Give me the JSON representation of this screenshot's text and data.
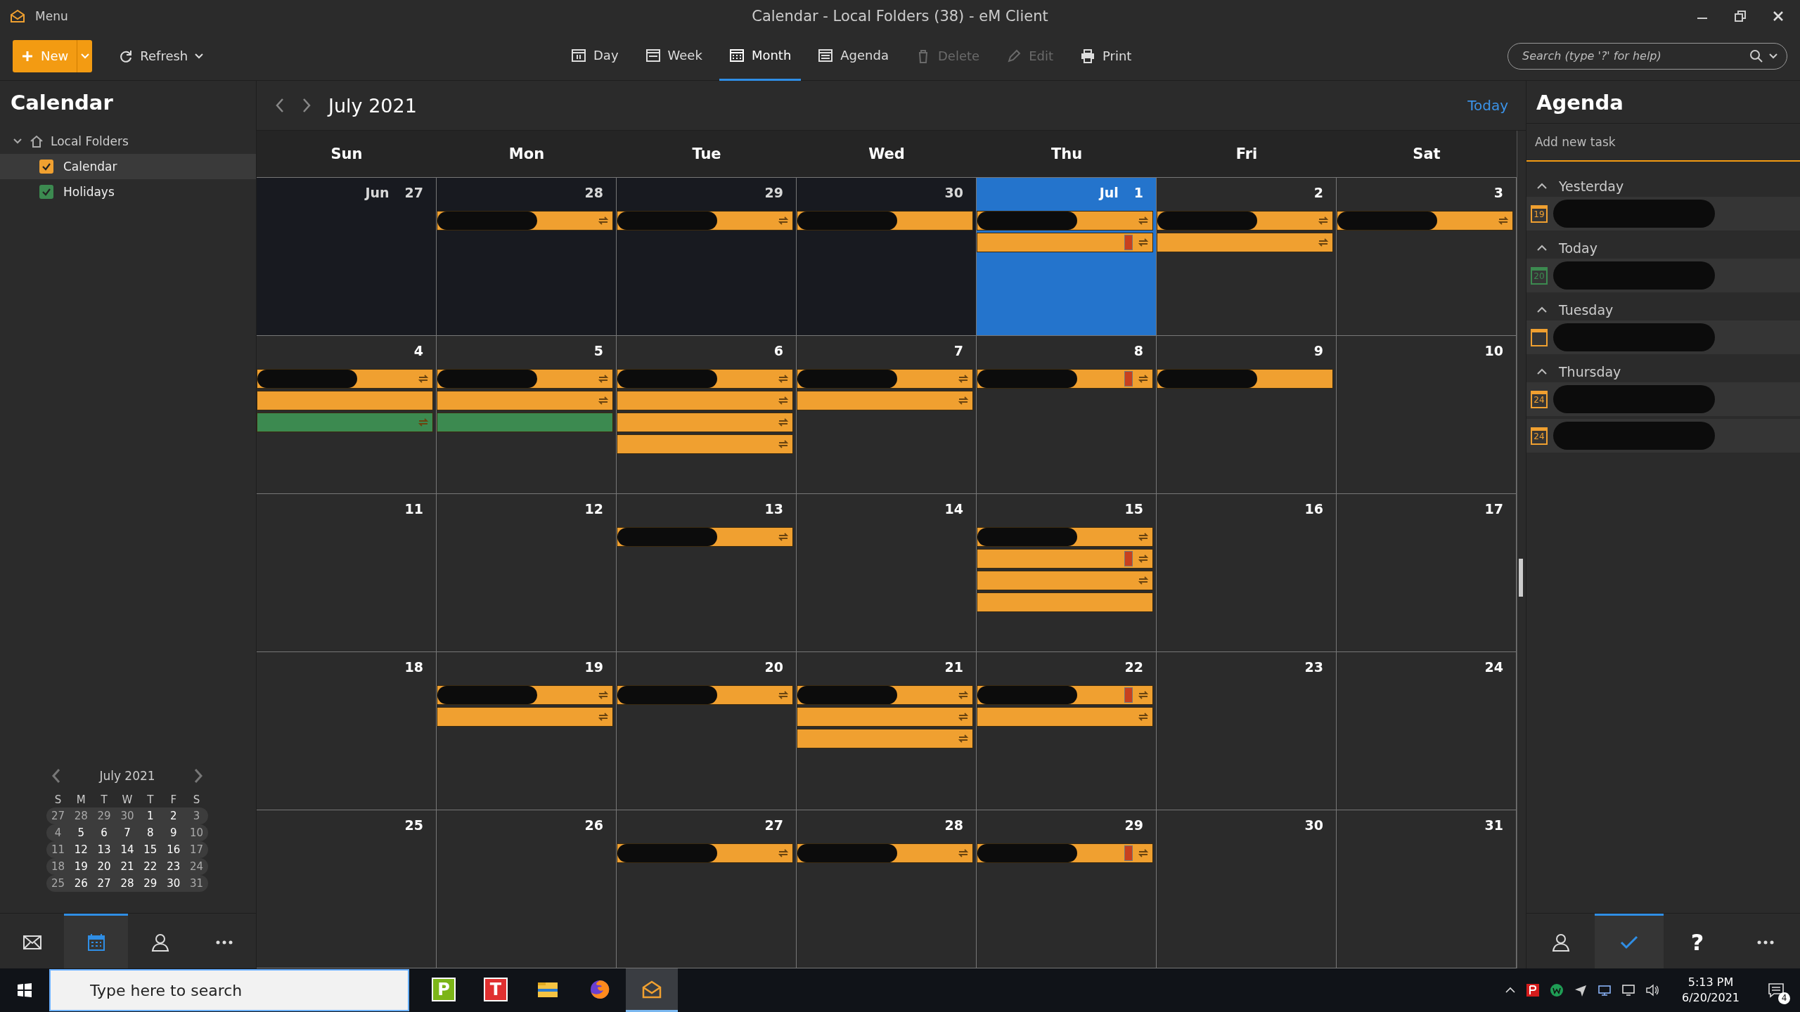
{
  "window": {
    "menu": "Menu",
    "title": "Calendar - Local Folders (38) - eM Client"
  },
  "toolbar": {
    "new": "New",
    "refresh": "Refresh",
    "views": [
      {
        "kind": "day",
        "label": "Day",
        "selected": false
      },
      {
        "kind": "week",
        "label": "Week",
        "selected": false
      },
      {
        "kind": "month",
        "label": "Month",
        "selected": true
      },
      {
        "kind": "agenda",
        "label": "Agenda",
        "selected": false
      }
    ],
    "actions": [
      {
        "kind": "delete",
        "label": "Delete",
        "disabled": true
      },
      {
        "kind": "edit",
        "label": "Edit",
        "disabled": true
      },
      {
        "kind": "print",
        "label": "Print",
        "disabled": false
      }
    ],
    "search": {
      "placeholder": "Search (type '?' for help)"
    }
  },
  "sidebar": {
    "title": "Calendar",
    "tree": [
      {
        "label": "Local Folders",
        "expanded": true,
        "children": [
          {
            "label": "Calendar",
            "checked": true,
            "selected": true,
            "color": "#f0a030"
          },
          {
            "label": "Holidays",
            "checked": true,
            "selected": false,
            "color": "#3c8a50"
          }
        ]
      }
    ],
    "mini_calendar": {
      "title": "July 2021",
      "weekdays": [
        "S",
        "M",
        "T",
        "W",
        "T",
        "F",
        "S"
      ],
      "weeks": [
        [
          {
            "d": "27",
            "dim": true
          },
          {
            "d": "28",
            "dim": true
          },
          {
            "d": "29",
            "dim": true
          },
          {
            "d": "30",
            "dim": true
          },
          {
            "d": "1",
            "dim": false
          },
          {
            "d": "2",
            "dim": false
          },
          {
            "d": "3",
            "dim": true
          }
        ],
        [
          {
            "d": "4",
            "dim": true
          },
          {
            "d": "5",
            "dim": false
          },
          {
            "d": "6",
            "dim": false
          },
          {
            "d": "7",
            "dim": false
          },
          {
            "d": "8",
            "dim": false
          },
          {
            "d": "9",
            "dim": false
          },
          {
            "d": "10",
            "dim": true
          }
        ],
        [
          {
            "d": "11",
            "dim": true
          },
          {
            "d": "12",
            "dim": false
          },
          {
            "d": "13",
            "dim": false
          },
          {
            "d": "14",
            "dim": false
          },
          {
            "d": "15",
            "dim": false
          },
          {
            "d": "16",
            "dim": false
          },
          {
            "d": "17",
            "dim": true
          }
        ],
        [
          {
            "d": "18",
            "dim": true
          },
          {
            "d": "19",
            "dim": false
          },
          {
            "d": "20",
            "dim": false
          },
          {
            "d": "21",
            "dim": false
          },
          {
            "d": "22",
            "dim": false
          },
          {
            "d": "23",
            "dim": false
          },
          {
            "d": "24",
            "dim": true
          }
        ],
        [
          {
            "d": "25",
            "dim": true
          },
          {
            "d": "26",
            "dim": false
          },
          {
            "d": "27",
            "dim": false
          },
          {
            "d": "28",
            "dim": false
          },
          {
            "d": "29",
            "dim": false
          },
          {
            "d": "30",
            "dim": false
          },
          {
            "d": "31",
            "dim": true
          }
        ]
      ]
    },
    "nav": [
      {
        "kind": "mail",
        "selected": false
      },
      {
        "kind": "calendar",
        "selected": true
      },
      {
        "kind": "contacts",
        "selected": false
      },
      {
        "kind": "more",
        "selected": false
      }
    ]
  },
  "calendar": {
    "title": "July 2021",
    "today_button": "Today",
    "weekdays": [
      "Sun",
      "Mon",
      "Tue",
      "Wed",
      "Thu",
      "Fri",
      "Sat"
    ],
    "weeks": [
      [
        {
          "month": "Jun",
          "day": "27",
          "outside": true,
          "selected": false
        },
        {
          "day": "28",
          "outside": true,
          "selected": false,
          "events": [
            {
              "color": "#f0a030",
              "recurring": true,
              "flag": false,
              "redacted": true
            }
          ]
        },
        {
          "day": "29",
          "outside": true,
          "selected": false,
          "events": [
            {
              "color": "#f0a030",
              "recurring": true,
              "flag": false,
              "redacted": true
            }
          ]
        },
        {
          "day": "30",
          "outside": true,
          "selected": false,
          "events": [
            {
              "color": "#f0a030",
              "recurring": false,
              "flag": false,
              "redacted": true
            }
          ]
        },
        {
          "month": "Jul",
          "day": "1",
          "outside": false,
          "selected": true,
          "events": [
            {
              "color": "#f0a030",
              "recurring": true,
              "flag": false,
              "redacted": true
            },
            {
              "color": "#f0a030",
              "recurring": true,
              "flag": true,
              "redacted": false
            }
          ]
        },
        {
          "day": "2",
          "outside": false,
          "selected": false,
          "events": [
            {
              "color": "#f0a030",
              "recurring": true,
              "flag": false,
              "redacted": true
            },
            {
              "color": "#f0a030",
              "recurring": true,
              "flag": false,
              "redacted": false
            }
          ]
        },
        {
          "day": "3",
          "outside": false,
          "selected": false,
          "events": [
            {
              "color": "#f0a030",
              "recurring": true,
              "flag": false,
              "redacted": true
            }
          ]
        }
      ],
      [
        {
          "day": "4",
          "outside": false,
          "selected": false,
          "events": [
            {
              "color": "#f0a030",
              "recurring": true,
              "flag": false,
              "redacted": true
            },
            {
              "color": "#f0a030",
              "recurring": false,
              "flag": false,
              "redacted": false
            },
            {
              "color": "#3c8a50",
              "recurring": true,
              "flag": false,
              "redacted": false
            }
          ]
        },
        {
          "day": "5",
          "outside": false,
          "selected": false,
          "events": [
            {
              "color": "#f0a030",
              "recurring": true,
              "flag": false,
              "redacted": true
            },
            {
              "color": "#f0a030",
              "recurring": true,
              "flag": false,
              "redacted": false
            },
            {
              "color": "#3c8a50",
              "recurring": false,
              "flag": false,
              "redacted": false
            }
          ]
        },
        {
          "day": "6",
          "outside": false,
          "selected": false,
          "events": [
            {
              "color": "#f0a030",
              "recurring": true,
              "flag": false,
              "redacted": true
            },
            {
              "color": "#f0a030",
              "recurring": true,
              "flag": false,
              "redacted": false
            },
            {
              "color": "#f0a030",
              "recurring": true,
              "flag": false,
              "redacted": false
            },
            {
              "color": "#f0a030",
              "recurring": true,
              "flag": false,
              "redacted": false
            }
          ]
        },
        {
          "day": "7",
          "outside": false,
          "selected": false,
          "events": [
            {
              "color": "#f0a030",
              "recurring": true,
              "flag": false,
              "redacted": true
            },
            {
              "color": "#f0a030",
              "recurring": true,
              "flag": false,
              "redacted": false
            }
          ]
        },
        {
          "day": "8",
          "outside": false,
          "selected": false,
          "events": [
            {
              "color": "#f0a030",
              "recurring": true,
              "flag": true,
              "redacted": true
            }
          ]
        },
        {
          "day": "9",
          "outside": false,
          "selected": false,
          "events": [
            {
              "color": "#f0a030",
              "recurring": false,
              "flag": false,
              "redacted": true
            }
          ]
        },
        {
          "day": "10",
          "outside": false,
          "selected": false
        }
      ],
      [
        {
          "day": "11",
          "outside": false,
          "selected": false
        },
        {
          "day": "12",
          "outside": false,
          "selected": false
        },
        {
          "day": "13",
          "outside": false,
          "selected": false,
          "events": [
            {
              "color": "#f0a030",
              "recurring": true,
              "flag": false,
              "redacted": true
            }
          ]
        },
        {
          "day": "14",
          "outside": false,
          "selected": false
        },
        {
          "day": "15",
          "outside": false,
          "selected": false,
          "events": [
            {
              "color": "#f0a030",
              "recurring": true,
              "flag": false,
              "redacted": true
            },
            {
              "color": "#f0a030",
              "recurring": true,
              "flag": true,
              "redacted": false
            },
            {
              "color": "#f0a030",
              "recurring": true,
              "flag": false,
              "redacted": false
            },
            {
              "color": "#f0a030",
              "recurring": false,
              "flag": false,
              "redacted": false
            }
          ]
        },
        {
          "day": "16",
          "outside": false,
          "selected": false
        },
        {
          "day": "17",
          "outside": false,
          "selected": false
        }
      ],
      [
        {
          "day": "18",
          "outside": false,
          "selected": false
        },
        {
          "day": "19",
          "outside": false,
          "selected": false,
          "events": [
            {
              "color": "#f0a030",
              "recurring": true,
              "flag": false,
              "redacted": true
            },
            {
              "color": "#f0a030",
              "recurring": true,
              "flag": false,
              "redacted": false
            }
          ]
        },
        {
          "day": "20",
          "outside": false,
          "selected": false,
          "events": [
            {
              "color": "#f0a030",
              "recurring": true,
              "flag": false,
              "redacted": true
            }
          ]
        },
        {
          "day": "21",
          "outside": false,
          "selected": false,
          "events": [
            {
              "color": "#f0a030",
              "recurring": true,
              "flag": false,
              "redacted": true
            },
            {
              "color": "#f0a030",
              "recurring": true,
              "flag": false,
              "redacted": false
            },
            {
              "color": "#f0a030",
              "recurring": true,
              "flag": false,
              "redacted": false
            }
          ]
        },
        {
          "day": "22",
          "outside": false,
          "selected": false,
          "events": [
            {
              "color": "#f0a030",
              "recurring": true,
              "flag": true,
              "redacted": true
            },
            {
              "color": "#f0a030",
              "recurring": true,
              "flag": false,
              "redacted": false
            }
          ]
        },
        {
          "day": "23",
          "outside": false,
          "selected": false
        },
        {
          "day": "24",
          "outside": false,
          "selected": false
        }
      ],
      [
        {
          "day": "25",
          "outside": false,
          "selected": false
        },
        {
          "day": "26",
          "outside": false,
          "selected": false
        },
        {
          "day": "27",
          "outside": false,
          "selected": false,
          "events": [
            {
              "color": "#f0a030",
              "recurring": true,
              "flag": false,
              "redacted": true
            }
          ]
        },
        {
          "day": "28",
          "outside": false,
          "selected": false,
          "events": [
            {
              "color": "#f0a030",
              "recurring": true,
              "flag": false,
              "redacted": true
            }
          ]
        },
        {
          "day": "29",
          "outside": false,
          "selected": false,
          "events": [
            {
              "color": "#f0a030",
              "recurring": true,
              "flag": true,
              "redacted": true
            }
          ]
        },
        {
          "day": "30",
          "outside": false,
          "selected": false
        },
        {
          "day": "31",
          "outside": false,
          "selected": false
        }
      ]
    ]
  },
  "agenda": {
    "title": "Agenda",
    "new_task": {
      "placeholder": "Add new task"
    },
    "groups": [
      {
        "label": "Yesterday",
        "expanded": true,
        "items": [
          {
            "icon_day": "19",
            "color": "#f0a030"
          }
        ]
      },
      {
        "label": "Today",
        "expanded": true,
        "items": [
          {
            "icon_day": "20",
            "color": "#3c8a50"
          }
        ]
      },
      {
        "label": "Tuesday",
        "expanded": true,
        "items": [
          {
            "color": "#f0a030"
          }
        ]
      },
      {
        "label": "Thursday",
        "expanded": true,
        "items": [
          {
            "icon_day": "24",
            "color": "#f0a030"
          },
          {
            "icon_day": "24",
            "color": "#f0a030"
          }
        ]
      }
    ],
    "nav": [
      {
        "kind": "contacts",
        "selected": false
      },
      {
        "kind": "tasks",
        "selected": true
      },
      {
        "kind": "help",
        "label": "?",
        "selected": false
      },
      {
        "kind": "more",
        "selected": false
      }
    ]
  },
  "taskbar": {
    "search": {
      "placeholder": "Type here to search"
    },
    "apps": [
      {
        "kind": "letter",
        "label": "P",
        "color": "#7cb518",
        "selected": false
      },
      {
        "kind": "letter",
        "label": "T",
        "color": "#e03030",
        "selected": false
      },
      {
        "kind": "folder",
        "selected": false
      },
      {
        "kind": "browser",
        "selected": false
      },
      {
        "kind": "mail",
        "selected": true
      }
    ],
    "tray": {
      "time": "5:13 PM",
      "date": "6/20/2021",
      "notifications": "4"
    }
  }
}
